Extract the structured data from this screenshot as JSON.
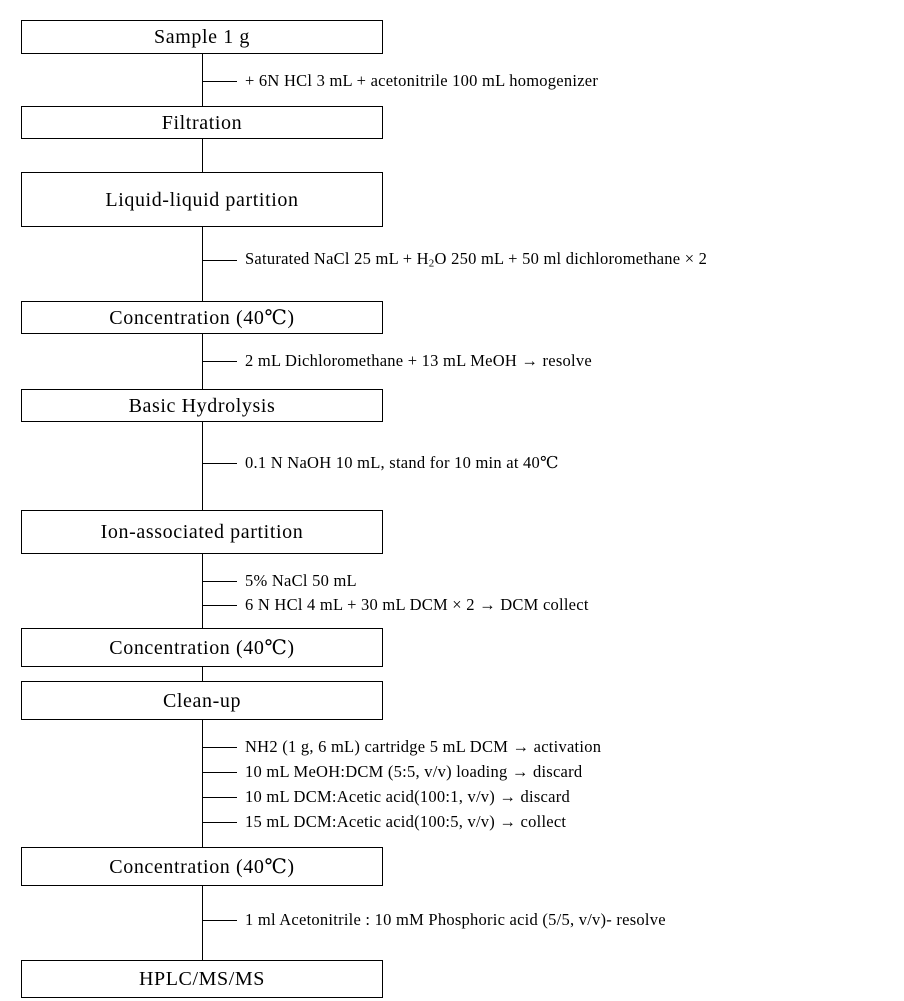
{
  "diagram": {
    "title": "Analytical sample preparation flowchart",
    "type": "vertical-process-flowchart",
    "colors": {
      "line": "#000000",
      "background": "#ffffff",
      "text": "#000000"
    },
    "nodes": [
      {
        "id": "sample",
        "label": "Sample 1 g"
      },
      {
        "id": "filtration",
        "label": "Filtration"
      },
      {
        "id": "ll-partition",
        "label": "Liquid-liquid partition"
      },
      {
        "id": "concentration1",
        "label": "Concentration (40℃)"
      },
      {
        "id": "hydrolysis",
        "label": "Basic Hydrolysis"
      },
      {
        "id": "ion-partition",
        "label": "Ion-associated partition"
      },
      {
        "id": "concentration2",
        "label": "Concentration (40℃)"
      },
      {
        "id": "cleanup",
        "label": "Clean-up"
      },
      {
        "id": "concentration3",
        "label": "Concentration (40℃)"
      },
      {
        "id": "hplc",
        "label": "HPLC/MS/MS"
      }
    ],
    "annotations": [
      {
        "id": "a1",
        "text": "+ 6N HCl 3 mL + acetonitrile 100 mL homogenizer"
      },
      {
        "id": "a2",
        "html": "Saturated NaCl 25 mL + H<sub>2</sub>O 250 mL + 50 ml dichloromethane × 2",
        "text": "Saturated NaCl 25 mL + H2O 250 mL + 50 ml dichloromethane × 2"
      },
      {
        "id": "a3",
        "text": "2 mL Dichloromethane + 13 mL MeOH → resolve"
      },
      {
        "id": "a4",
        "text": "0.1 N NaOH 10 mL, stand for 10 min at 40℃"
      },
      {
        "id": "a5",
        "text": "5% NaCl 50 mL"
      },
      {
        "id": "a6",
        "text": "6 N HCl 4 mL + 30 mL DCM × 2 → DCM collect"
      },
      {
        "id": "a7",
        "text": "NH2 (1 g, 6 mL) cartridge 5 mL DCM → activation"
      },
      {
        "id": "a8",
        "text": "10 mL MeOH:DCM (5:5, v/v) loading → discard"
      },
      {
        "id": "a9",
        "text": "10 mL DCM:Acetic acid(100:1, v/v) → discard"
      },
      {
        "id": "a10",
        "text": "15 mL DCM:Acetic acid(100:5, v/v) → collect"
      },
      {
        "id": "a11",
        "text": "1 ml Acetonitrile : 10 mM Phosphoric acid (5/5, v/v)- resolve"
      }
    ]
  }
}
